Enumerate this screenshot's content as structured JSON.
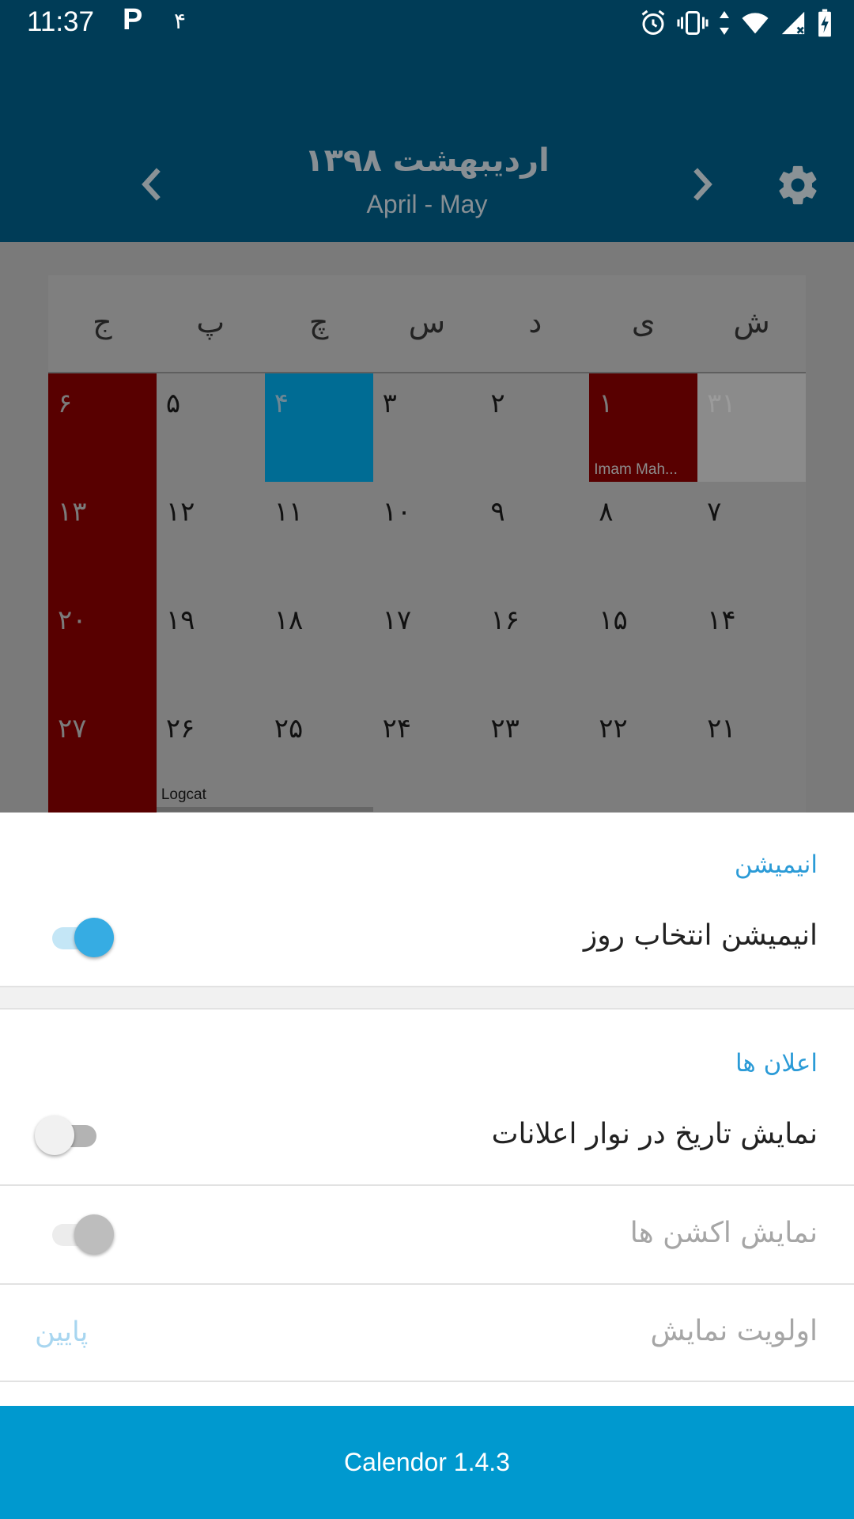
{
  "status_bar": {
    "time": "11:37",
    "parking_icon_text": "P",
    "notification_count": "۴",
    "icons": [
      "alarm-icon",
      "vibrate-icon",
      "data-arrows-icon",
      "wifi-icon",
      "signal-icon",
      "battery-charging-icon"
    ]
  },
  "header": {
    "title": "اردیبهشت ۱۳۹۸",
    "subtitle": "April - May",
    "icons": [
      "chevron-left-icon",
      "chevron-right-icon",
      "gear-icon"
    ]
  },
  "calendar": {
    "weekdays": [
      "ش",
      "ی",
      "د",
      "س",
      "چ",
      "پ",
      "ج"
    ],
    "weeks": [
      [
        {
          "num": "۳۱",
          "type": "other"
        },
        {
          "num": "۱",
          "type": "holiday",
          "event": "Imam Mah..."
        },
        {
          "num": "۲"
        },
        {
          "num": "۳"
        },
        {
          "num": "۴",
          "type": "today"
        },
        {
          "num": "۵"
        },
        {
          "num": "۶",
          "type": "holiday"
        }
      ],
      [
        {
          "num": "۷"
        },
        {
          "num": "۸"
        },
        {
          "num": "۹"
        },
        {
          "num": "۱۰"
        },
        {
          "num": "۱۱"
        },
        {
          "num": "۱۲"
        },
        {
          "num": "۱۳",
          "type": "holiday"
        }
      ],
      [
        {
          "num": "۱۴"
        },
        {
          "num": "۱۵"
        },
        {
          "num": "۱۶"
        },
        {
          "num": "۱۷"
        },
        {
          "num": "۱۸"
        },
        {
          "num": "۱۹"
        },
        {
          "num": "۲۰",
          "type": "holiday"
        }
      ],
      [
        {
          "num": "۲۱"
        },
        {
          "num": "۲۲"
        },
        {
          "num": "۲۳"
        },
        {
          "num": "۲۴"
        },
        {
          "num": "۲۵"
        },
        {
          "num": "۲۶",
          "event": "Logcat",
          "event_dark": true
        },
        {
          "num": "۲۷",
          "type": "holiday"
        }
      ]
    ]
  },
  "settings": {
    "animation_section": "انیمیشن",
    "day_select_animation_label": "انیمیشن انتخاب روز",
    "day_select_animation_on": true,
    "notifications_section": "اعلان ها",
    "show_date_in_notification_label": "نمایش تاریخ در نوار اعلانات",
    "show_date_in_notification_on": false,
    "show_actions_label": "نمایش اکشن ها",
    "show_actions_enabled": false,
    "priority_label": "اولویت نمایش",
    "priority_value": "پایین"
  },
  "footer": {
    "version": "Calendor 1.4.3"
  },
  "colors": {
    "header_bg": "#003c57",
    "holiday": "#580000",
    "today": "#006c94",
    "accent": "#2b9bd7",
    "footer_bg": "#0099cf"
  }
}
